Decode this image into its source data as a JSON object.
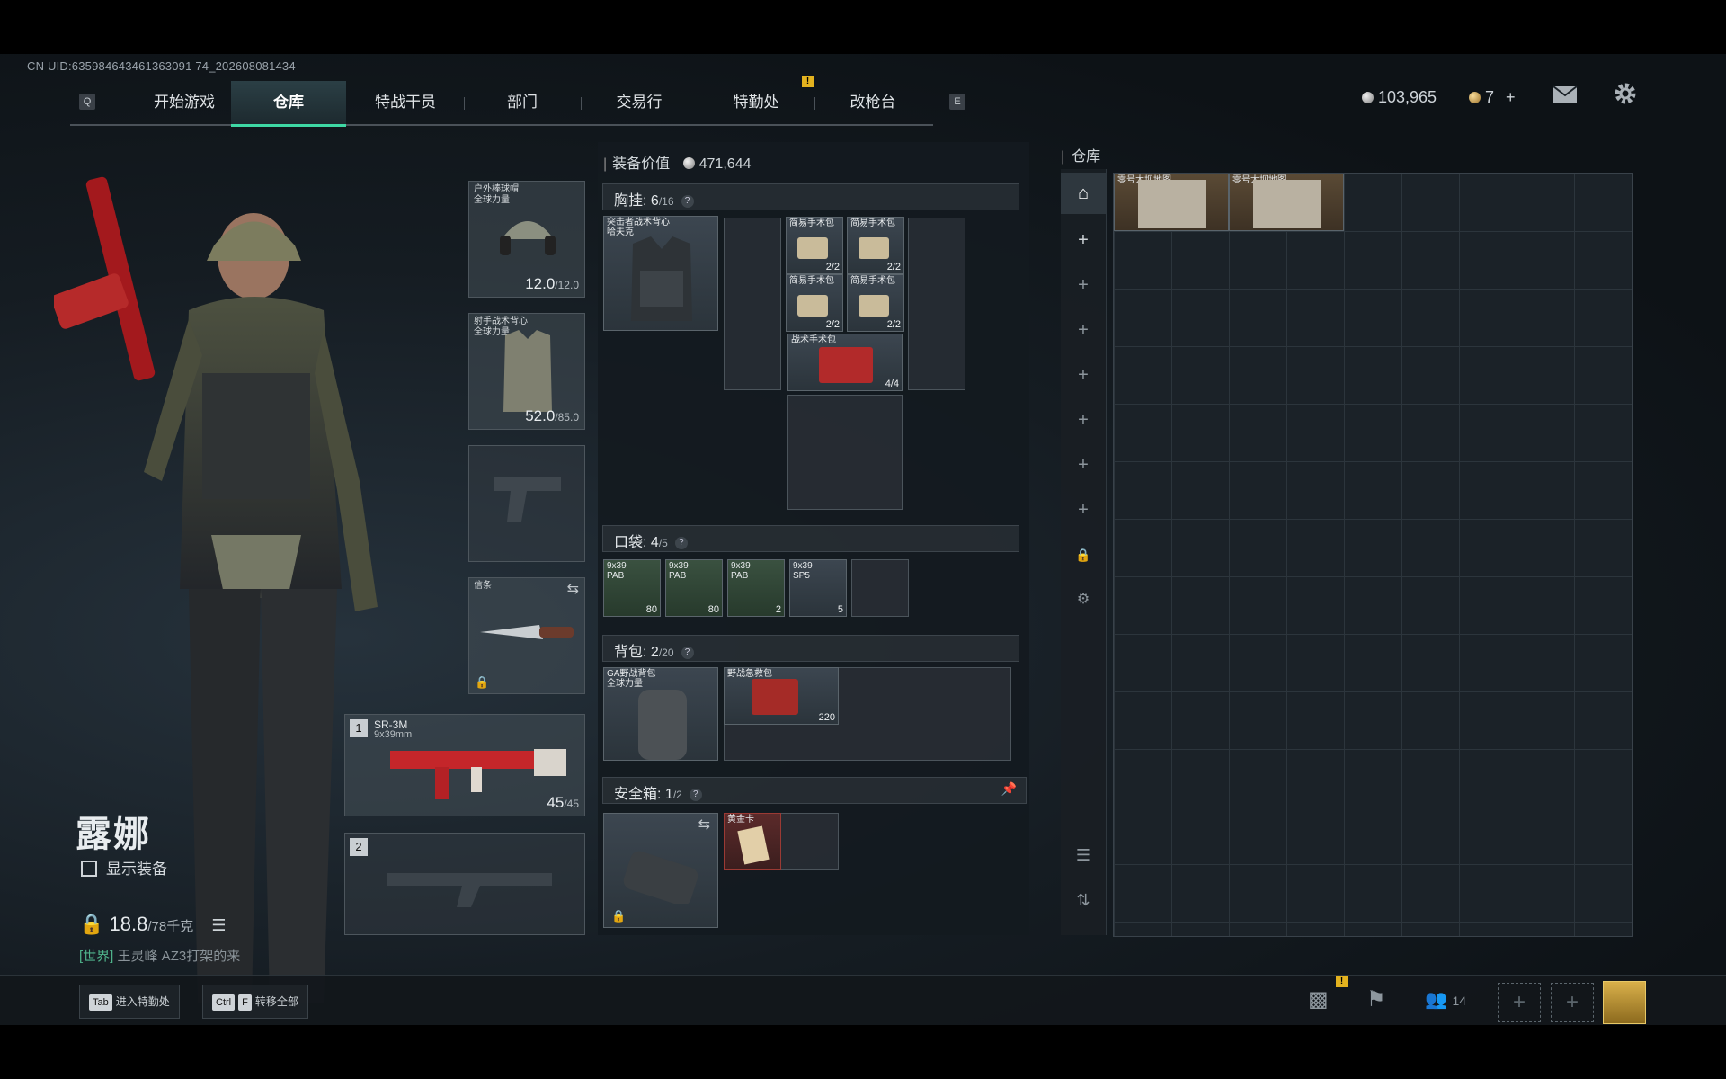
{
  "uid": "CN UID:635984643461363091 74_202608081434",
  "nav": {
    "left_key": "Q",
    "right_key": "E",
    "tabs": [
      "开始游戏",
      "仓库",
      "特战干员",
      "部门",
      "交易行",
      "特勤处",
      "改枪台"
    ],
    "active_tab": "仓库"
  },
  "currency": {
    "silver": "103,965",
    "gold": "7",
    "add": "+"
  },
  "character": {
    "name": "露娜",
    "show_gear_label": "显示装备",
    "weight": "18.8",
    "weight_max": "/78千克",
    "chat_tag": "[世界]",
    "chat_text": "王灵峰 AZ3打架的来"
  },
  "gear": {
    "helmet": {
      "label": "户外棒球帽\n全球力量",
      "durability": "12.0",
      "durability_max": "/12.0"
    },
    "armor": {
      "label": "射手战术背心\n全球力量",
      "durability": "52.0",
      "durability_max": "/85.0"
    },
    "melee": {
      "label": "信条"
    },
    "primary": {
      "slot": "1",
      "name": "SR-3M",
      "caliber": "9x39mm",
      "ammo": "45",
      "ammo_max": "/45"
    },
    "secondary": {
      "slot": "2"
    }
  },
  "middle": {
    "value_label": "装备价值",
    "value": "471,644",
    "chest": {
      "title": "胸挂:",
      "count": "6",
      "max": "/16",
      "rig_label": "突击者战术背心\n哈夫克"
    },
    "chest_items": [
      {
        "label": "简易手术包",
        "count": "2/2"
      },
      {
        "label": "简易手术包",
        "count": "2/2"
      },
      {
        "label": "简易手术包",
        "count": "2/2"
      },
      {
        "label": "简易手术包",
        "count": "2/2"
      },
      {
        "label": "战术手术包",
        "count": "4/4"
      }
    ],
    "pocket": {
      "title": "口袋:",
      "count": "4",
      "max": "/5"
    },
    "pocket_items": [
      {
        "label": "9x39\nPAB",
        "count": "80"
      },
      {
        "label": "9x39\nPAB",
        "count": "80"
      },
      {
        "label": "9x39\nPAB",
        "count": "2"
      },
      {
        "label": "9x39\nSP5",
        "count": "5"
      }
    ],
    "backpack": {
      "title": "背包:",
      "count": "2",
      "max": "/20",
      "bag_label": "GA野战背包\n全球力量"
    },
    "backpack_items": [
      {
        "label": "野战急救包",
        "count": "220"
      }
    ],
    "safebox": {
      "title": "安全箱:",
      "count": "1",
      "max": "/2"
    },
    "safebox_items": [
      {
        "label": "黄金卡"
      }
    ]
  },
  "stash": {
    "title": "仓库",
    "items": [
      {
        "label": "零号大坝地图"
      },
      {
        "label": "零号大坝地图"
      }
    ]
  },
  "bottom": {
    "btn1_key": "Tab",
    "btn1_label": "进入特勤处",
    "btn2_key1": "Ctrl",
    "btn2_key2": "F",
    "btn2_label": "转移全部",
    "friends_count": "14"
  }
}
